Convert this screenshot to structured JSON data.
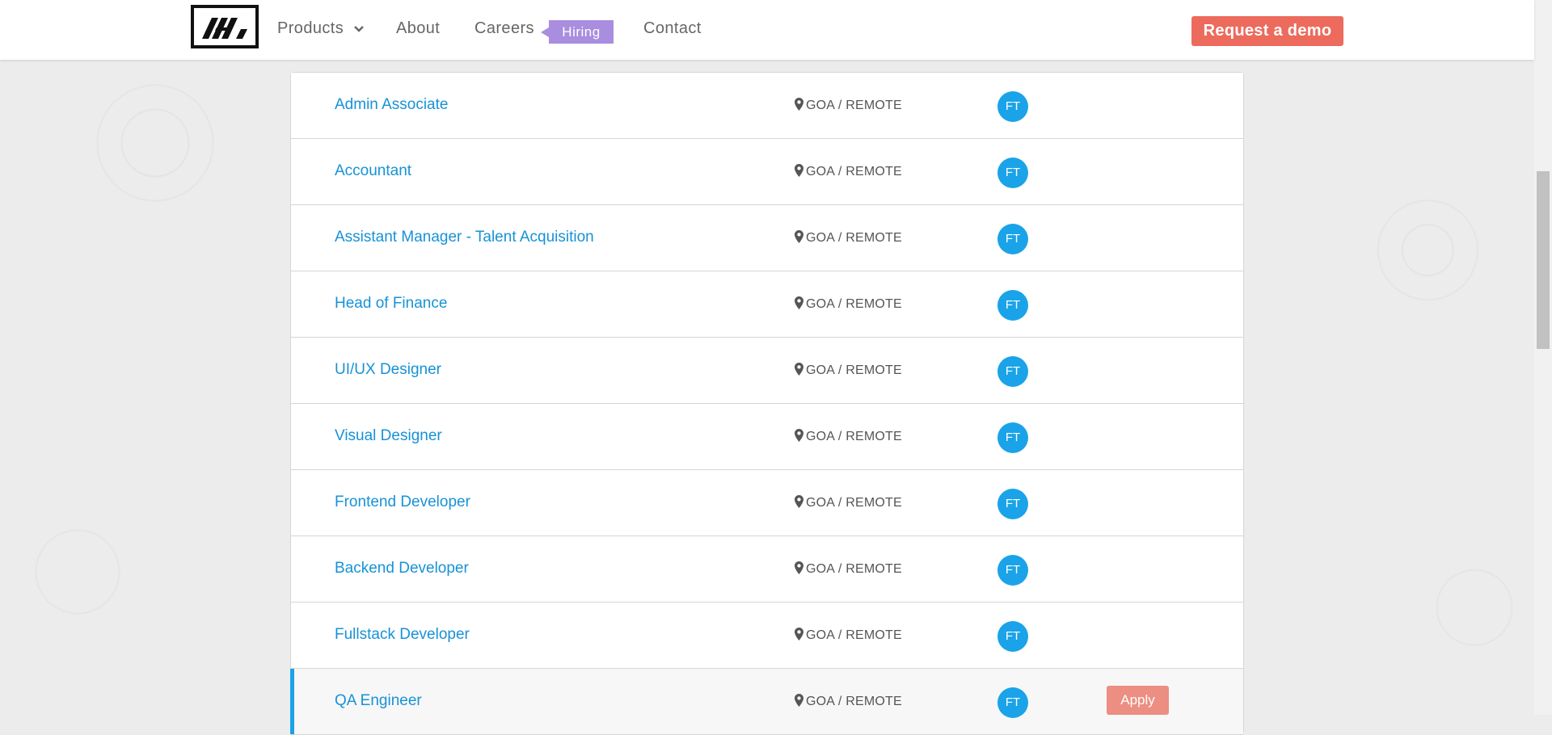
{
  "header": {
    "nav": {
      "products": "Products",
      "about": "About",
      "careers": "Careers",
      "hiring_badge": "Hiring",
      "contact": "Contact"
    },
    "demo_button": "Request a demo"
  },
  "jobs": [
    {
      "title": "Admin Associate",
      "location": "GOA / REMOTE",
      "type": "FT"
    },
    {
      "title": "Accountant",
      "location": "GOA / REMOTE",
      "type": "FT"
    },
    {
      "title": "Assistant Manager - Talent Acquisition",
      "location": "GOA / REMOTE",
      "type": "FT"
    },
    {
      "title": "Head of Finance",
      "location": "GOA / REMOTE",
      "type": "FT"
    },
    {
      "title": "UI/UX Designer",
      "location": "GOA / REMOTE",
      "type": "FT"
    },
    {
      "title": "Visual Designer",
      "location": "GOA / REMOTE",
      "type": "FT"
    },
    {
      "title": "Frontend Developer",
      "location": "GOA / REMOTE",
      "type": "FT"
    },
    {
      "title": "Backend Developer",
      "location": "GOA / REMOTE",
      "type": "FT"
    },
    {
      "title": "Fullstack Developer",
      "location": "GOA / REMOTE",
      "type": "FT"
    },
    {
      "title": "QA Engineer",
      "location": "GOA / REMOTE",
      "type": "FT",
      "apply": "Apply"
    }
  ],
  "colors": {
    "accent_blue": "#1aa3e8",
    "link_blue": "#1792d6",
    "demo_red": "#ec6b5d",
    "hiring_purple": "#a98ddf"
  }
}
